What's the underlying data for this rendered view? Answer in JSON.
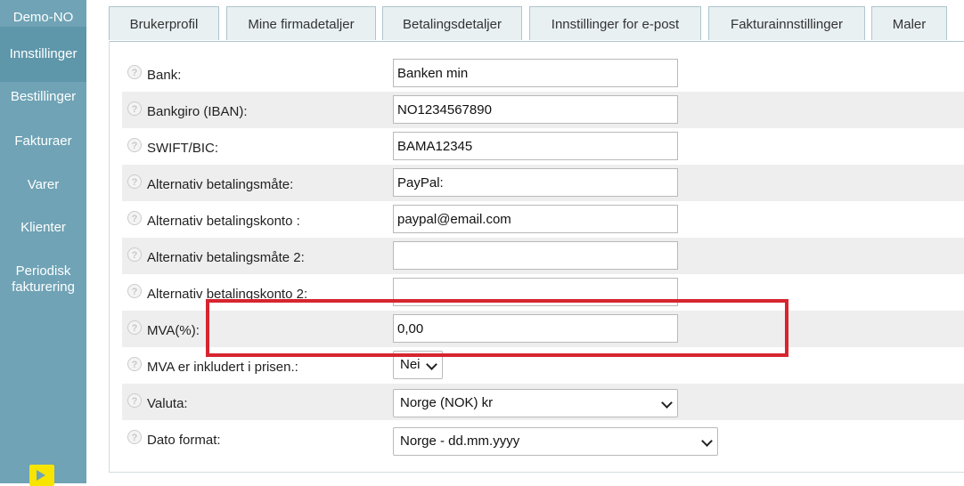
{
  "sidebar": {
    "account": "Demo-NO",
    "items": [
      {
        "label": "Innstillinger",
        "active": true
      },
      {
        "label": "Bestillinger"
      },
      {
        "label": "Fakturaer"
      },
      {
        "label": "Varer"
      },
      {
        "label": "Klienter"
      },
      {
        "label": "Periodisk fakturering"
      }
    ],
    "bottom_icon": "exit-arrow-icon"
  },
  "tabs": [
    {
      "label": "Brukerprofil"
    },
    {
      "label": "Mine firmadetaljer"
    },
    {
      "label": "Betalingsdetaljer",
      "active": true
    },
    {
      "label": "Innstillinger for e-post"
    },
    {
      "label": "Fakturainnstillinger"
    },
    {
      "label": "Maler"
    }
  ],
  "form": {
    "help_icon": "?",
    "fields": [
      {
        "label": "Bank:",
        "value": "Banken min"
      },
      {
        "label": "Bankgiro (IBAN):",
        "value": "NO1234567890"
      },
      {
        "label": "SWIFT/BIC:",
        "value": "BAMA12345"
      },
      {
        "label": "Alternativ betalingsmåte:",
        "value": "PayPal:"
      },
      {
        "label": "Alternativ betalingskonto :",
        "value": "paypal@email.com"
      },
      {
        "label": "Alternativ betalingsmåte 2:",
        "value": ""
      },
      {
        "label": "Alternativ betalingskonto 2:",
        "value": ""
      },
      {
        "label": "MVA(%):",
        "value": "0,00"
      },
      {
        "label": "MVA er inkludert i prisen.:",
        "value": "Nei"
      },
      {
        "label": "Valuta:",
        "value": "Norge (NOK) kr"
      },
      {
        "label": "Dato format:",
        "value": "Norge - dd.mm.yyyy"
      }
    ]
  },
  "colors": {
    "sidebar": "#6fa3b5",
    "highlight": "#d6252f"
  }
}
